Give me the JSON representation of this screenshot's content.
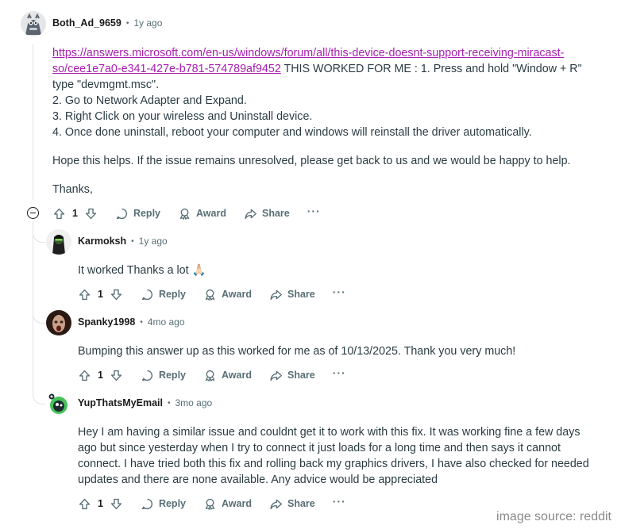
{
  "comments": [
    {
      "author": "Both_Ad_9659",
      "age": "1y ago",
      "link_text": "https://answers.microsoft.com/en-us/windows/forum/all/this-device-doesnt-support-receiving-miracast-so/cee1e7a0-e341-427e-b781-574789af9452",
      "link_line1": "https://answers.microsoft.com/en-us/windows/forum/all/this-device-doesnt-support-receiving-miracast-",
      "link_line2": "so/cee1e7a0-e341-427e-b781-574789af9452",
      "after_link": " THIS WORKED FOR ME : 1. Press and hold \"Window + R\"",
      "line2": "type \"devmgmt.msc\".",
      "line3": "2. Go to Network Adapter and Expand.",
      "line4": "3. Right Click on your wireless and Uninstall device.",
      "line5": "4. Once done uninstall, reboot your computer and windows will reinstall the driver automatically.",
      "para2": "Hope this helps. If the issue remains unresolved, please get back to us and we would be happy to help.",
      "para3": "Thanks,",
      "votes": "1"
    },
    {
      "author": "Karmoksh",
      "age": "1y ago",
      "text": "It worked Thanks a lot 🙏🏻",
      "votes": "1"
    },
    {
      "author": "Spanky1998",
      "age": "4mo ago",
      "text": "Bumping this answer up as this worked for me as of 10/13/2025. Thank you very much!",
      "votes": "1"
    },
    {
      "author": "YupThatsMyEmail",
      "age": "3mo ago",
      "text": "Hey I am having a similar issue and couldnt get it to work with this fix. It was working fine a few days ago but since yesterday when I try to connect it just loads for a long time and then says it cannot connect. I have tried both this fix and rolling back my graphics drivers, I have also checked for needed updates and there are none available. Any advice would be appreciated",
      "votes": "1"
    }
  ],
  "actions": {
    "reply": "Reply",
    "award": "Award",
    "share": "Share",
    "more": "···"
  },
  "separator": "•",
  "watermark": "image source: reddit"
}
